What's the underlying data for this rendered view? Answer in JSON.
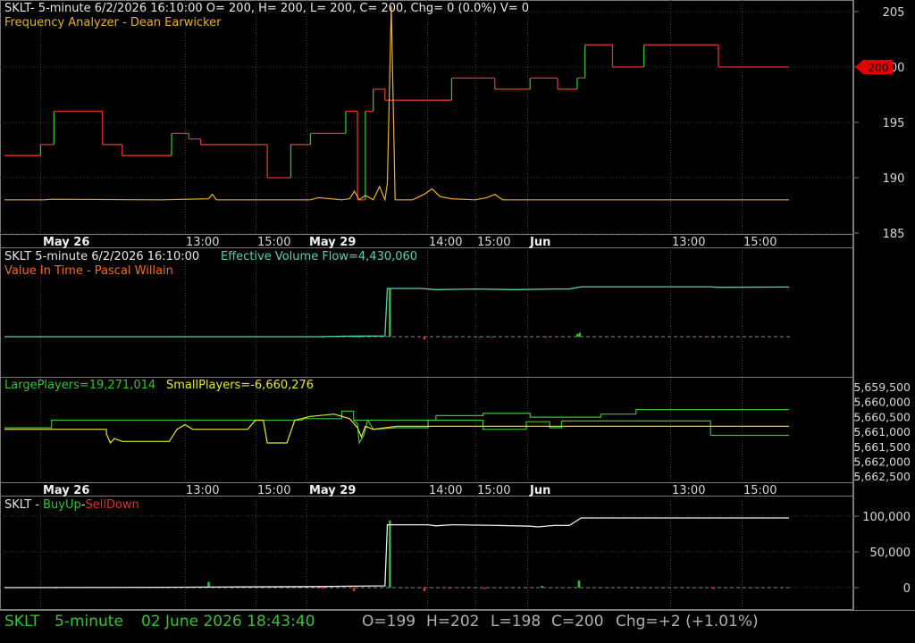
{
  "colors": {
    "background": "#000000",
    "grid": "#3a3a3a",
    "border": "#7a7a7a",
    "price_red": "#e03028",
    "price_green": "#30c030",
    "frequency": "#e8b030",
    "volume_flow": "#5ad0b8",
    "large_players": "#39c039",
    "small_players": "#e8e830",
    "buyup": "#f0f0f0",
    "label_green": "#39c039",
    "label_red": "#e03028",
    "label_orange": "#e6702a",
    "price_flag": "#e00000"
  },
  "panel1": {
    "header": "SKLT- 5-minute 6/2/2026 16:10:00 O= 200, H= 200, L= 200, C= 200, Chg= 0 (0.0%) V= 0",
    "subtitle": "Frequency Analyzer - Dean Earwicker",
    "price_flag": "200"
  },
  "panel2": {
    "header_left": "SKLT 5-minute  6/2/2026 16:10:00",
    "header_right": "Effective Volume Flow=4,430,060",
    "subtitle": "Value In Time - Pascal Willain"
  },
  "panel3": {
    "large_label": "LargePlayers=19,271,014",
    "small_label": "SmallPlayers=-6,660,276"
  },
  "panel4": {
    "title_prefix": "SKLT - ",
    "buy_label": "BuyUp",
    "dash": "-",
    "sell_label": "SellDown"
  },
  "status": {
    "symbol": "SKLT",
    "interval": "5-minute",
    "datetime": "02 June 2026 18:43:40",
    "o": "O=199",
    "h": "H=202",
    "l": "L=198",
    "c": "C=200",
    "chg": "Chg=+2 (+1.01%)"
  },
  "chart_data": [
    {
      "type": "line",
      "title": "SKLT- 5-minute 6/2/2026 16:10:00 O= 200, H= 200, L= 200, C= 200, Chg= 0 (0.0%) V= 0",
      "x_tick_labels": [
        "May 26",
        "13:00",
        "15:00",
        "May 29",
        "14:00",
        "15:00",
        "Jun",
        "13:00",
        "15:00"
      ],
      "y_ticks": [
        185,
        190,
        195,
        200,
        205
      ],
      "ylim": [
        184,
        205
      ],
      "last_value": 200,
      "x_start": 0,
      "x_end": 100,
      "series": [
        {
          "name": "",
          "kind": "step",
          "points": [
            [
              0,
              192
            ],
            [
              4.6,
              192
            ],
            [
              4.6,
              193
            ],
            [
              6.3,
              193
            ],
            [
              6.3,
              196
            ],
            [
              12.5,
              196
            ],
            [
              12.5,
              193
            ],
            [
              15,
              193
            ],
            [
              15,
              192
            ],
            [
              21.3,
              192
            ],
            [
              21.3,
              194
            ],
            [
              23.5,
              194
            ],
            [
              23.5,
              193.5
            ],
            [
              25,
              193.5
            ],
            [
              25,
              193
            ],
            [
              33.5,
              193
            ],
            [
              33.5,
              190
            ],
            [
              36.5,
              190
            ],
            [
              36.5,
              193
            ],
            [
              39,
              193
            ],
            [
              39,
              194
            ],
            [
              43.5,
              194
            ],
            [
              43.5,
              196
            ],
            [
              45,
              196
            ],
            [
              45,
              188
            ],
            [
              46,
              188
            ],
            [
              46,
              196
            ],
            [
              47,
              196
            ],
            [
              47,
              198
            ],
            [
              48.5,
              198
            ],
            [
              48.5,
              197
            ],
            [
              57,
              197
            ],
            [
              57,
              199
            ],
            [
              62.5,
              199
            ],
            [
              62.5,
              198
            ],
            [
              67,
              198
            ],
            [
              67,
              199
            ],
            [
              70.5,
              199
            ],
            [
              70.5,
              198
            ],
            [
              73,
              198
            ],
            [
              73,
              199
            ],
            [
              74,
              199
            ],
            [
              74,
              202
            ],
            [
              77.5,
              202
            ],
            [
              77.5,
              200
            ],
            [
              81.5,
              200
            ],
            [
              81.5,
              202
            ],
            [
              91,
              202
            ],
            [
              91,
              200
            ],
            [
              100,
              200
            ]
          ]
        },
        {
          "name": "Frequency Analyzer - Dean Earwicker",
          "kind": "line",
          "points": [
            [
              0,
              188
            ],
            [
              5,
              188
            ],
            [
              6,
              188.05
            ],
            [
              20,
              188
            ],
            [
              26,
              188.1
            ],
            [
              26.5,
              188.5
            ],
            [
              27,
              188
            ],
            [
              39,
              188
            ],
            [
              40,
              188.2
            ],
            [
              43,
              188
            ],
            [
              44,
              188.1
            ],
            [
              44.6,
              188.8
            ],
            [
              45.2,
              188
            ],
            [
              46,
              188.4
            ],
            [
              47,
              188
            ],
            [
              47.8,
              189.2
            ],
            [
              48.5,
              188
            ],
            [
              48.8,
              189.5
            ],
            [
              49.3,
              205.5
            ],
            [
              49.8,
              188
            ],
            [
              52,
              188
            ],
            [
              53.5,
              188.5
            ],
            [
              54.5,
              189
            ],
            [
              55.5,
              188.3
            ],
            [
              57,
              188.1
            ],
            [
              60,
              188
            ],
            [
              61.5,
              188.2
            ],
            [
              62.5,
              188.5
            ],
            [
              63.5,
              188
            ],
            [
              100,
              188
            ]
          ]
        }
      ]
    },
    {
      "type": "line",
      "title": "SKLT 5-minute  6/2/2026 16:10:00",
      "x_tick_labels": [],
      "ylim": [
        -2000000,
        7000000
      ],
      "series": [
        {
          "name": "Effective Volume Flow",
          "kind": "line",
          "last_value": 4430060,
          "points": [
            [
              0,
              0
            ],
            [
              40,
              0
            ],
            [
              44,
              50000
            ],
            [
              48.5,
              60000
            ],
            [
              48.8,
              4300000
            ],
            [
              53,
              4300000
            ],
            [
              55,
              4200000
            ],
            [
              60,
              4250000
            ],
            [
              65,
              4200000
            ],
            [
              70,
              4250000
            ],
            [
              72,
              4250000
            ],
            [
              73.5,
              4450000
            ],
            [
              90,
              4450000
            ],
            [
              91,
              4400000
            ],
            [
              100,
              4430060
            ]
          ]
        },
        {
          "name": "Value In Time - Pascal Willain",
          "kind": "bars",
          "values": [
            [
              40.5,
              0
            ],
            [
              44.5,
              -80000
            ],
            [
              45.2,
              -100000
            ],
            [
              49.1,
              4300000
            ],
            [
              53.5,
              -250000
            ],
            [
              56.5,
              -50000
            ],
            [
              60.5,
              -40000
            ],
            [
              62,
              -60000
            ],
            [
              69,
              -30000
            ],
            [
              73,
              250000
            ],
            [
              73.3,
              350000
            ],
            [
              90.3,
              -80000
            ]
          ]
        }
      ]
    },
    {
      "type": "line",
      "title": "",
      "y_tick_labels": [
        "5,659,500",
        "5,660,000",
        "5,660,500",
        "5,661,000",
        "5,661,500",
        "5,662,000",
        "5,662,500"
      ],
      "x_tick_labels": [
        "May 26",
        "13:00",
        "15:00",
        "May 29",
        "14:00",
        "15:00",
        "Jun",
        "13:00",
        "15:00"
      ],
      "ylim": [
        0,
        12
      ],
      "series": [
        {
          "name": "LargePlayers",
          "kind": "step",
          "last_value": 19271014,
          "points": [
            [
              0,
              6
            ],
            [
              6,
              6
            ],
            [
              6,
              7
            ],
            [
              38,
              7
            ],
            [
              38,
              7.2
            ],
            [
              43,
              7.2
            ],
            [
              43,
              8.2
            ],
            [
              44.5,
              8.2
            ],
            [
              44.5,
              7
            ],
            [
              55,
              7
            ],
            [
              55,
              7.6
            ],
            [
              61,
              7.6
            ],
            [
              61,
              7.9
            ],
            [
              67,
              7.9
            ],
            [
              67,
              7.4
            ],
            [
              76,
              7.4
            ],
            [
              76,
              7.8
            ],
            [
              80.5,
              7.8
            ],
            [
              80.5,
              8.4
            ],
            [
              100,
              8.4
            ]
          ]
        },
        {
          "name": "LargePlayers-lower",
          "kind": "step",
          "points": [
            [
              44.5,
              7
            ],
            [
              45,
              6.5
            ],
            [
              45.2,
              4
            ],
            [
              45.8,
              5
            ],
            [
              46.3,
              7
            ],
            [
              47,
              5.8
            ],
            [
              50,
              6
            ],
            [
              54,
              6
            ],
            [
              54,
              7
            ],
            [
              61,
              7
            ],
            [
              61,
              5.8
            ],
            [
              66.5,
              5.8
            ],
            [
              66.5,
              6.8
            ],
            [
              69.5,
              6.8
            ],
            [
              69.5,
              6
            ],
            [
              71,
              6
            ],
            [
              71,
              6.9
            ],
            [
              90,
              6.9
            ],
            [
              90,
              5
            ],
            [
              100,
              5
            ]
          ]
        },
        {
          "name": "SmallPlayers",
          "kind": "line",
          "last_value": -6660276,
          "points": [
            [
              0,
              5.8
            ],
            [
              13,
              5.8
            ],
            [
              13,
              5.2
            ],
            [
              13.5,
              4
            ],
            [
              14,
              4.6
            ],
            [
              15,
              4.2
            ],
            [
              21,
              4.2
            ],
            [
              22,
              5.8
            ],
            [
              23,
              6.4
            ],
            [
              24,
              5.8
            ],
            [
              31,
              5.8
            ],
            [
              32,
              7
            ],
            [
              33,
              7
            ],
            [
              33.5,
              4
            ],
            [
              36,
              4
            ],
            [
              37,
              7
            ],
            [
              39,
              7.5
            ],
            [
              42,
              7.8
            ],
            [
              44,
              7.2
            ],
            [
              45,
              6
            ],
            [
              45.5,
              4.8
            ],
            [
              46,
              6.2
            ],
            [
              47,
              5.8
            ],
            [
              50,
              6.2
            ],
            [
              100,
              6.2
            ]
          ]
        }
      ]
    },
    {
      "type": "line",
      "title": "SKLT - BuyUp-SellDown",
      "y_ticks": [
        0,
        50000,
        100000
      ],
      "y_tick_labels": [
        "0",
        "50,000",
        "100,000"
      ],
      "ylim": [
        -5000,
        115000
      ],
      "series": [
        {
          "name": "BuyUp",
          "kind": "line",
          "points": [
            [
              0,
              0
            ],
            [
              20,
              500
            ],
            [
              30,
              1000
            ],
            [
              40,
              1500
            ],
            [
              44,
              2000
            ],
            [
              48.5,
              2500
            ],
            [
              48.8,
              88000
            ],
            [
              54,
              88000
            ],
            [
              55,
              86500
            ],
            [
              57,
              88000
            ],
            [
              63,
              87000
            ],
            [
              67,
              86000
            ],
            [
              68,
              85000
            ],
            [
              70,
              87000
            ],
            [
              72,
              87000
            ],
            [
              73.5,
              97500
            ],
            [
              100,
              97500
            ]
          ]
        },
        {
          "name": "SellDown",
          "kind": "bars",
          "values": [
            [
              6.5,
              -800
            ],
            [
              26,
              8000
            ],
            [
              40.5,
              -700
            ],
            [
              44.5,
              -5000
            ],
            [
              49.1,
              94000
            ],
            [
              53.5,
              -5000
            ],
            [
              56.7,
              -1500
            ],
            [
              61.2,
              -2000
            ],
            [
              68.5,
              2500
            ],
            [
              73.2,
              10000
            ],
            [
              90.4,
              -2000
            ]
          ]
        }
      ]
    }
  ]
}
